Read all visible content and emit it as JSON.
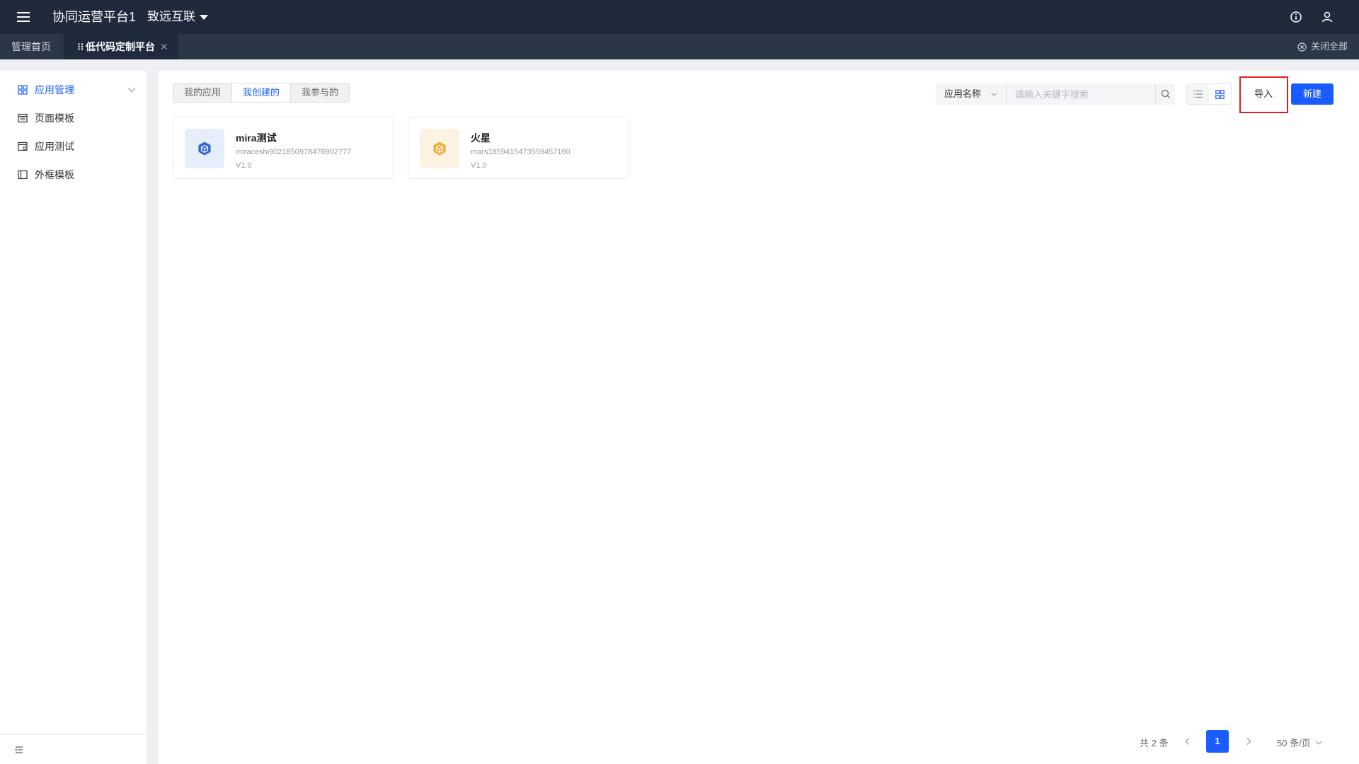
{
  "header": {
    "app_title": "协同运营平台1",
    "org_name": "致远互联"
  },
  "tabs": {
    "home": "管理首页",
    "active": "低代码定制平台",
    "active_close": "✕",
    "close_all": "关闭全部"
  },
  "sidebar": {
    "items": [
      {
        "label": "应用管理",
        "icon": "grid-icon",
        "active": true
      },
      {
        "label": "页面模板",
        "icon": "page-template-icon"
      },
      {
        "label": "应用测试",
        "icon": "app-test-icon"
      },
      {
        "label": "外框模板",
        "icon": "frame-template-icon"
      }
    ]
  },
  "toolbar": {
    "segments": [
      "我的应用",
      "我创建的",
      "我参与的"
    ],
    "active_segment": "我创建的",
    "search_field": "应用名称",
    "search_placeholder": "请输入关键字搜索",
    "import_label": "导入",
    "new_label": "新建"
  },
  "apps": [
    {
      "name": "mira测试",
      "code": "miraceshi9021850978476902777",
      "version": "V1.0",
      "icon": "cube-icon",
      "icon_color": "#2f64d4"
    },
    {
      "name": "火星",
      "code": "mars1859415473559457160",
      "version": "V1.0",
      "icon": "cube-icon",
      "icon_color": "#f0a93b"
    }
  ],
  "pagination": {
    "total": "共 2 条",
    "current": "1",
    "page_size": "50 条/页"
  },
  "colors": {
    "primary": "#1a5cff",
    "topbar": "#1f2a3c",
    "highlight": "#e02020"
  }
}
